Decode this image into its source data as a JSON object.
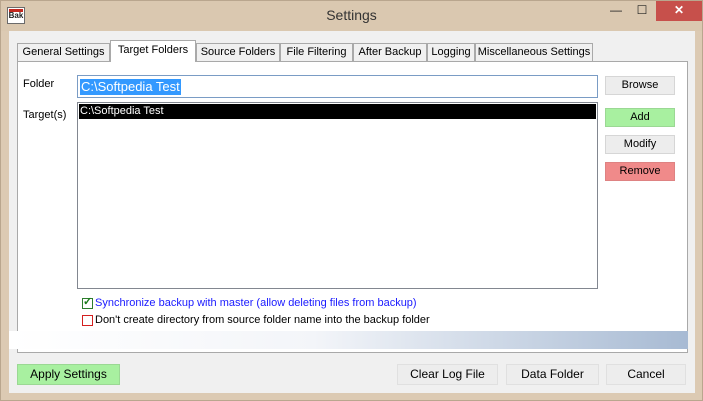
{
  "window": {
    "title": "Settings",
    "app_icon_text": "Bak",
    "minimize": "—",
    "maximize": "☐",
    "close": "✕"
  },
  "tabs": [
    {
      "label": "General Settings",
      "active": false
    },
    {
      "label": "Target Folders",
      "active": true
    },
    {
      "label": "Source Folders",
      "active": false
    },
    {
      "label": "File Filtering",
      "active": false
    },
    {
      "label": "After Backup",
      "active": false
    },
    {
      "label": "Logging",
      "active": false
    },
    {
      "label": "Miscellaneous Settings",
      "active": false
    }
  ],
  "target_folders": {
    "folder_label": "Folder",
    "folder_value": "C:\\Softpedia Test",
    "targets_label": "Target(s)",
    "targets": [
      "C:\\Softpedia Test"
    ],
    "buttons": {
      "browse": "Browse",
      "add": "Add",
      "modify": "Modify",
      "remove": "Remove"
    },
    "options": [
      {
        "label": "Synchronize backup with master (allow deleting files from backup)",
        "checked": true
      },
      {
        "label": "Don't create directory from source folder name into the backup folder",
        "checked": false
      }
    ]
  },
  "footer": {
    "apply": "Apply Settings",
    "clear_log": "Clear Log File",
    "data_folder": "Data Folder",
    "cancel": "Cancel"
  },
  "colors": {
    "green_button": "#a8f0a0",
    "red_button": "#f08a8a",
    "close_button": "#c7504b",
    "selection": "#3399ff",
    "link_text": "#1a1aff"
  }
}
